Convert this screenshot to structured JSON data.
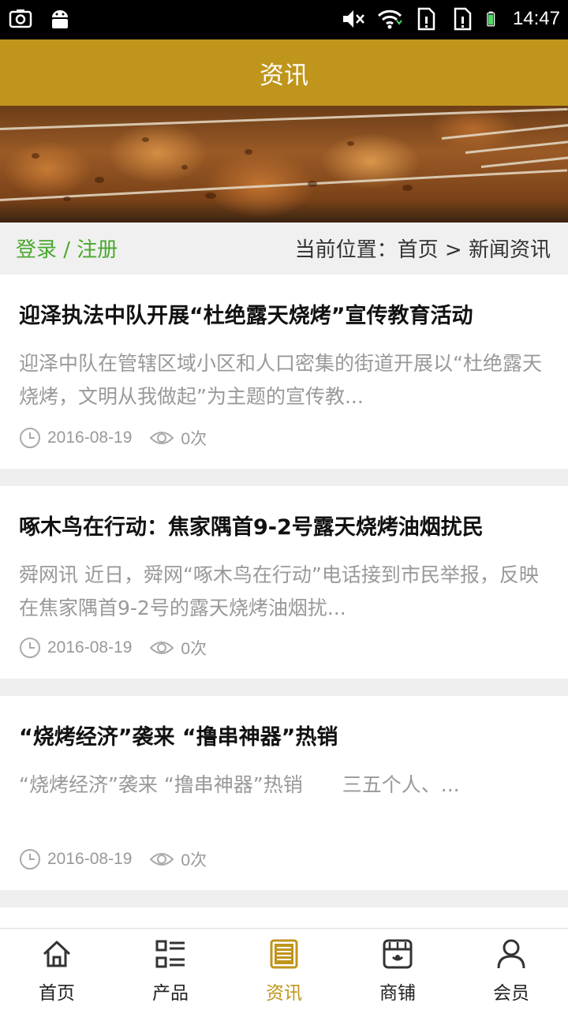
{
  "status_bar": {
    "time": "14:47",
    "icons": [
      "screenshot-icon",
      "android-icon",
      "mute-icon",
      "wifi-icon",
      "sim-alert-icon",
      "sim-alert-icon",
      "battery-icon"
    ]
  },
  "header": {
    "title": "资讯"
  },
  "location_bar": {
    "login_link": "登录 / 注册",
    "breadcrumb": "当前位置：首页 > 新闻资讯"
  },
  "articles": [
    {
      "title": "迎泽执法中队开展“杜绝露天烧烤”宣传教育活动",
      "summary": " 迎泽中队在管辖区域小区和人口密集的街道开展以“杜绝露天烧烤，文明从我做起”为主题的宣传教...",
      "date": "2016-08-19",
      "views": "0次"
    },
    {
      "title": "啄木鸟在行动：焦家隅首9-2号露天烧烤油烟扰民",
      "summary": "舜网讯 近日，舜网“啄木鸟在行动”电话接到市民举报，反映在焦家隅首9-2号的露天烧烤油烟扰...",
      "date": "2016-08-19",
      "views": "0次"
    },
    {
      "title": "“烧烤经济”袭来 “撸串神器”热销",
      "summary": " “烧烤经济”袭来 “撸串神器”热销　　三五个人、...",
      "date": "2016-08-19",
      "views": "0次"
    }
  ],
  "bottom_nav": [
    {
      "label": "首页",
      "icon": "home-icon",
      "active": false
    },
    {
      "label": "产品",
      "icon": "list-icon",
      "active": false
    },
    {
      "label": "资讯",
      "icon": "news-icon",
      "active": true
    },
    {
      "label": "商铺",
      "icon": "shop-icon",
      "active": false
    },
    {
      "label": "会员",
      "icon": "user-icon",
      "active": false
    }
  ],
  "colors": {
    "brand": "#c0951c",
    "login_green": "#4aa82e",
    "muted_text": "#999999"
  }
}
